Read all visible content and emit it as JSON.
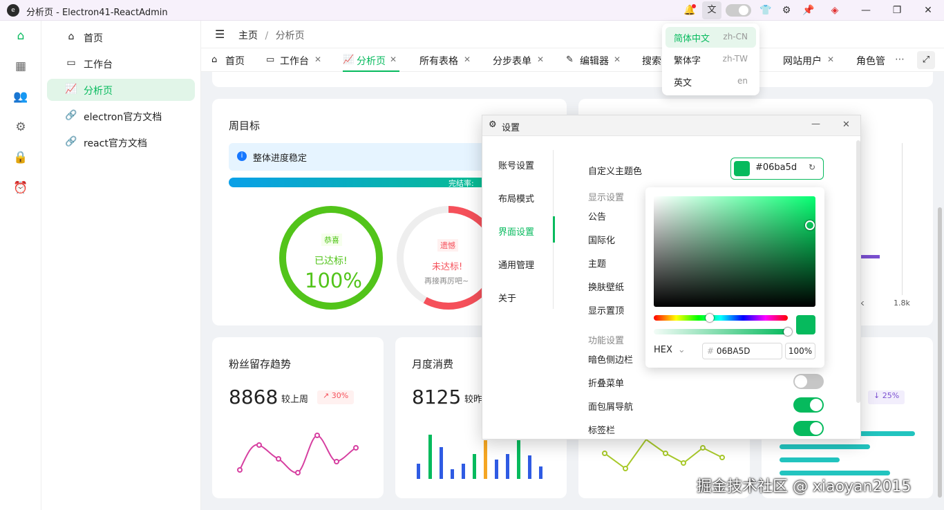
{
  "window": {
    "title": "分析页 - Electron41-ReactAdmin",
    "logo": "e"
  },
  "titlebar_icons": [
    "bell-icon",
    "translate-icon",
    "theme-toggle-icon",
    "shirt-icon",
    "gear-icon",
    "pin-icon",
    "react-icon",
    "minimize-icon",
    "maximize-icon",
    "close-icon"
  ],
  "sidebar": {
    "items": [
      {
        "label": "首页",
        "icon": "home-icon",
        "active": false
      },
      {
        "label": "工作台",
        "icon": "monitor-icon",
        "active": false
      },
      {
        "label": "分析页",
        "icon": "chart-line-icon",
        "active": true
      },
      {
        "label": "electron官方文档",
        "icon": "link-icon",
        "active": false
      },
      {
        "label": "react官方文档",
        "icon": "link-icon",
        "active": false
      }
    ]
  },
  "breadcrumb": {
    "root": "主页",
    "sep": "/",
    "current": "分析页"
  },
  "tabs": [
    {
      "label": "首页",
      "icon": "home-icon",
      "closable": false,
      "active": false
    },
    {
      "label": "工作台",
      "icon": "monitor-icon",
      "closable": true,
      "active": false
    },
    {
      "label": "分析页",
      "icon": "chart-line-icon",
      "closable": true,
      "active": true
    },
    {
      "label": "所有表格",
      "icon": "",
      "closable": true,
      "active": false
    },
    {
      "label": "分步表单",
      "icon": "",
      "closable": true,
      "active": false
    },
    {
      "label": "编辑器",
      "icon": "edit-icon",
      "closable": true,
      "active": false
    },
    {
      "label": "搜索",
      "icon": "",
      "closable": false,
      "active": false
    },
    {
      "label": "网站用户",
      "icon": "",
      "closable": true,
      "active": false
    },
    {
      "label": "角色管",
      "icon": "",
      "closable": false,
      "active": false
    }
  ],
  "lang_menu": [
    {
      "name": "简体中文",
      "code": "zh-CN",
      "active": true
    },
    {
      "name": "繁体字",
      "code": "zh-TW",
      "active": false
    },
    {
      "name": "英文",
      "code": "en",
      "active": false
    }
  ],
  "weekly": {
    "title": "周目标",
    "alert": "整体进度稳定",
    "progress_label": "完结率:",
    "ring1": {
      "tag": "恭喜",
      "status": "已达标!",
      "value": "100%",
      "color": "#52c41a",
      "progress": 1.0
    },
    "ring2": {
      "tag": "遗憾",
      "status": "未达标!",
      "sub": "再接再厉吧~",
      "color": "#f5505a",
      "progress": 0.58
    }
  },
  "right_chart": {
    "tick": "1.8k",
    "tick_partial": "k"
  },
  "fans": {
    "title": "粉丝留存趋势",
    "value": "8868",
    "compare": "较上周",
    "change": "30%",
    "trend": "up"
  },
  "monthly": {
    "title": "月度消费",
    "value": "8125",
    "compare": "较昨"
  },
  "card4": {
    "change": "25%",
    "trend": "down"
  },
  "settings": {
    "title": "设置",
    "nav": [
      {
        "label": "账号设置",
        "active": false
      },
      {
        "label": "布局模式",
        "active": false
      },
      {
        "label": "界面设置",
        "active": true
      },
      {
        "label": "通用管理",
        "active": false
      },
      {
        "label": "关于",
        "active": false
      }
    ],
    "theme_label": "自定义主题色",
    "theme_value": "#06ba5d",
    "display_group": "显示设置",
    "display_items": [
      "公告",
      "国际化",
      "主题",
      "换肤壁纸",
      "显示置顶"
    ],
    "func_group": "功能设置",
    "func_items": [
      {
        "label": "暗色侧边栏",
        "on": null
      },
      {
        "label": "折叠菜单",
        "on": false
      },
      {
        "label": "面包屑导航",
        "on": true
      },
      {
        "label": "标签栏",
        "on": true
      }
    ]
  },
  "color_picker": {
    "mode": "HEX",
    "hex_prefix": "#",
    "hex": "06BA5D",
    "alpha": "100%",
    "color": "#06ba5d"
  },
  "watermark": "掘金技术社区 @ xiaoyan2015",
  "colors": {
    "accent": "#06ba5d",
    "success": "#52c41a",
    "danger": "#f5505a",
    "purple": "#7a4fd0",
    "teal": "#22c4bf"
  }
}
